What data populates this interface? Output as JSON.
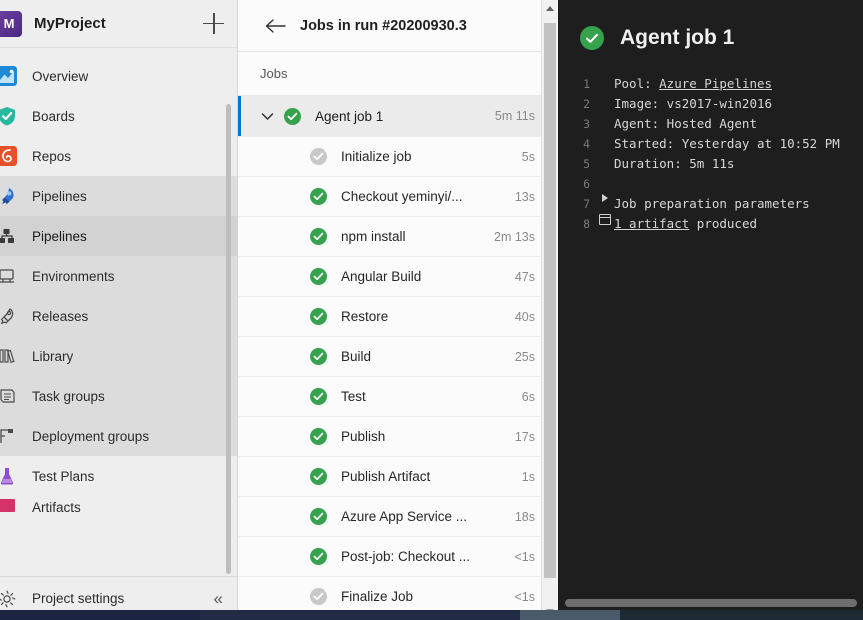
{
  "sidebar": {
    "project": {
      "avatar_letter": "M",
      "name": "MyProject",
      "add_label": "+"
    },
    "items": [
      {
        "label": "Overview",
        "icon": "overview-icon",
        "state": "normal"
      },
      {
        "label": "Boards",
        "icon": "boards-icon",
        "state": "normal"
      },
      {
        "label": "Repos",
        "icon": "repos-icon",
        "state": "normal"
      },
      {
        "label": "Pipelines",
        "icon": "pipelines-icon",
        "state": "group-selected"
      },
      {
        "label": "Pipelines",
        "icon": "pipelines-sub-icon",
        "state": "selected"
      },
      {
        "label": "Environments",
        "icon": "environments-icon",
        "state": "group-selected"
      },
      {
        "label": "Releases",
        "icon": "releases-icon",
        "state": "group-selected"
      },
      {
        "label": "Library",
        "icon": "library-icon",
        "state": "group-selected"
      },
      {
        "label": "Task groups",
        "icon": "task-groups-icon",
        "state": "group-selected"
      },
      {
        "label": "Deployment groups",
        "icon": "deployment-groups-icon",
        "state": "group-selected"
      },
      {
        "label": "Test Plans",
        "icon": "test-plans-icon",
        "state": "normal"
      },
      {
        "label": "Artifacts",
        "icon": "artifacts-icon",
        "state": "normal"
      }
    ],
    "footer": {
      "settings_label": "Project settings",
      "collapse_label": "«"
    }
  },
  "jobs_panel": {
    "back_label": "←",
    "title": "Jobs in run #20200930.3",
    "section_label": "Jobs",
    "parent_job": {
      "name": "Agent job 1",
      "duration": "5m 11s",
      "status": "succeeded",
      "chevron": "⌄"
    },
    "tasks": [
      {
        "name": "Initialize job",
        "duration": "5s",
        "status": "skipped"
      },
      {
        "name": "Checkout yeminyi/...",
        "duration": "13s",
        "status": "succeeded"
      },
      {
        "name": "npm install",
        "duration": "2m 13s",
        "status": "succeeded"
      },
      {
        "name": "Angular Build",
        "duration": "47s",
        "status": "succeeded"
      },
      {
        "name": "Restore",
        "duration": "40s",
        "status": "succeeded"
      },
      {
        "name": "Build",
        "duration": "25s",
        "status": "succeeded"
      },
      {
        "name": "Test",
        "duration": "6s",
        "status": "succeeded"
      },
      {
        "name": "Publish",
        "duration": "17s",
        "status": "succeeded"
      },
      {
        "name": "Publish Artifact",
        "duration": "1s",
        "status": "succeeded"
      },
      {
        "name": "Azure App Service ...",
        "duration": "18s",
        "status": "succeeded"
      },
      {
        "name": "Post-job: Checkout ...",
        "duration": "<1s",
        "status": "succeeded"
      },
      {
        "name": "Finalize Job",
        "duration": "<1s",
        "status": "skipped"
      }
    ]
  },
  "log_panel": {
    "title": "Agent job 1",
    "status": "succeeded",
    "lines": [
      {
        "n": "1",
        "gutter": "",
        "pre": "Pool: ",
        "link": "Azure Pipelines",
        "post": ""
      },
      {
        "n": "2",
        "gutter": "",
        "pre": "Image: vs2017-win2016",
        "link": "",
        "post": ""
      },
      {
        "n": "3",
        "gutter": "",
        "pre": "Agent: Hosted Agent",
        "link": "",
        "post": ""
      },
      {
        "n": "4",
        "gutter": "",
        "pre": "Started: Yesterday at 10:52 PM",
        "link": "",
        "post": ""
      },
      {
        "n": "5",
        "gutter": "",
        "pre": "Duration: 5m 11s",
        "link": "",
        "post": ""
      },
      {
        "n": "6",
        "gutter": "",
        "pre": "",
        "link": "",
        "post": ""
      },
      {
        "n": "7",
        "gutter": "expand-triangle",
        "pre": "Job preparation parameters",
        "link": "",
        "post": ""
      },
      {
        "n": "8",
        "gutter": "artifact-icon",
        "pre": "",
        "link": "1 artifact",
        "post": " produced"
      }
    ]
  },
  "colors": {
    "success_green": "#36a24c",
    "skipped_grey": "#c8c8c8",
    "accent_blue": "#0078d4",
    "log_background": "#1e1e1e",
    "sidebar_background": "#eeeeee"
  }
}
